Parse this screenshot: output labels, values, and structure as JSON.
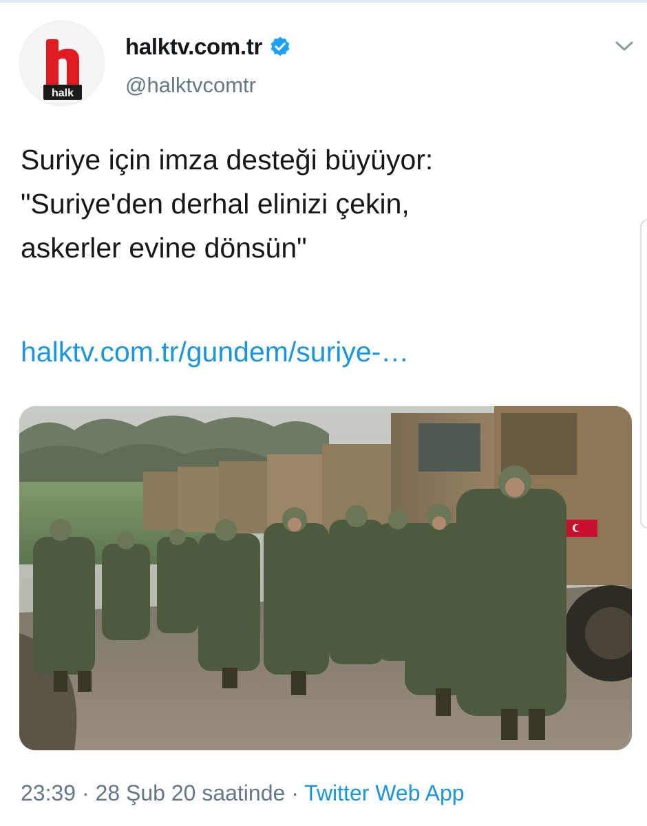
{
  "account": {
    "display_name": "halktv.com.tr",
    "handle": "@halktvcomtr",
    "avatar_label": "halk",
    "verified": true
  },
  "tweet": {
    "text_lines": [
      "Suriye için imza desteği büyüyor:",
      "\"Suriye'den derhal elinizi çekin,",
      "askerler evine dönsün\""
    ],
    "link": "halktv.com.tr/gundem/suriye-…"
  },
  "meta": {
    "time": "23:39",
    "separator": "·",
    "date": "28 Şub 20 saatinde",
    "source_app": "Twitter Web App"
  },
  "colors": {
    "link": "#1b95e0",
    "muted": "#657786",
    "text": "#14171a",
    "verified": "#1da1f2",
    "brand_red": "#e11b22"
  },
  "icons": {
    "verified": "verified-badge-icon",
    "menu": "chevron-down-icon"
  }
}
